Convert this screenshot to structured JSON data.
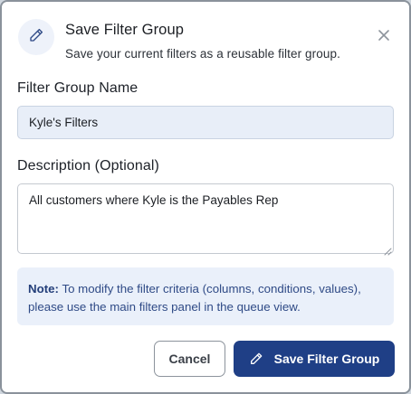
{
  "dialog": {
    "header_icon": "pencil-icon",
    "title": "Save Filter Group",
    "subtitle": "Save your current filters as a reusable filter group.",
    "close_icon": "close-icon"
  },
  "form": {
    "name_label": "Filter Group Name",
    "name_value": "Kyle's Filters",
    "description_label": "Description (Optional)",
    "description_value": "All customers where Kyle is the Payables Rep"
  },
  "note": {
    "prefix": "Note:",
    "text": " To modify the filter criteria (columns, conditions, values), please use the main filters panel in the queue view."
  },
  "actions": {
    "cancel_label": "Cancel",
    "save_label": "Save Filter Group",
    "save_icon": "pencil-icon"
  },
  "colors": {
    "primary": "#1f3f86",
    "note_background": "#eaf0fa",
    "note_text": "#2f4a86",
    "input_background": "#e8eef8"
  }
}
